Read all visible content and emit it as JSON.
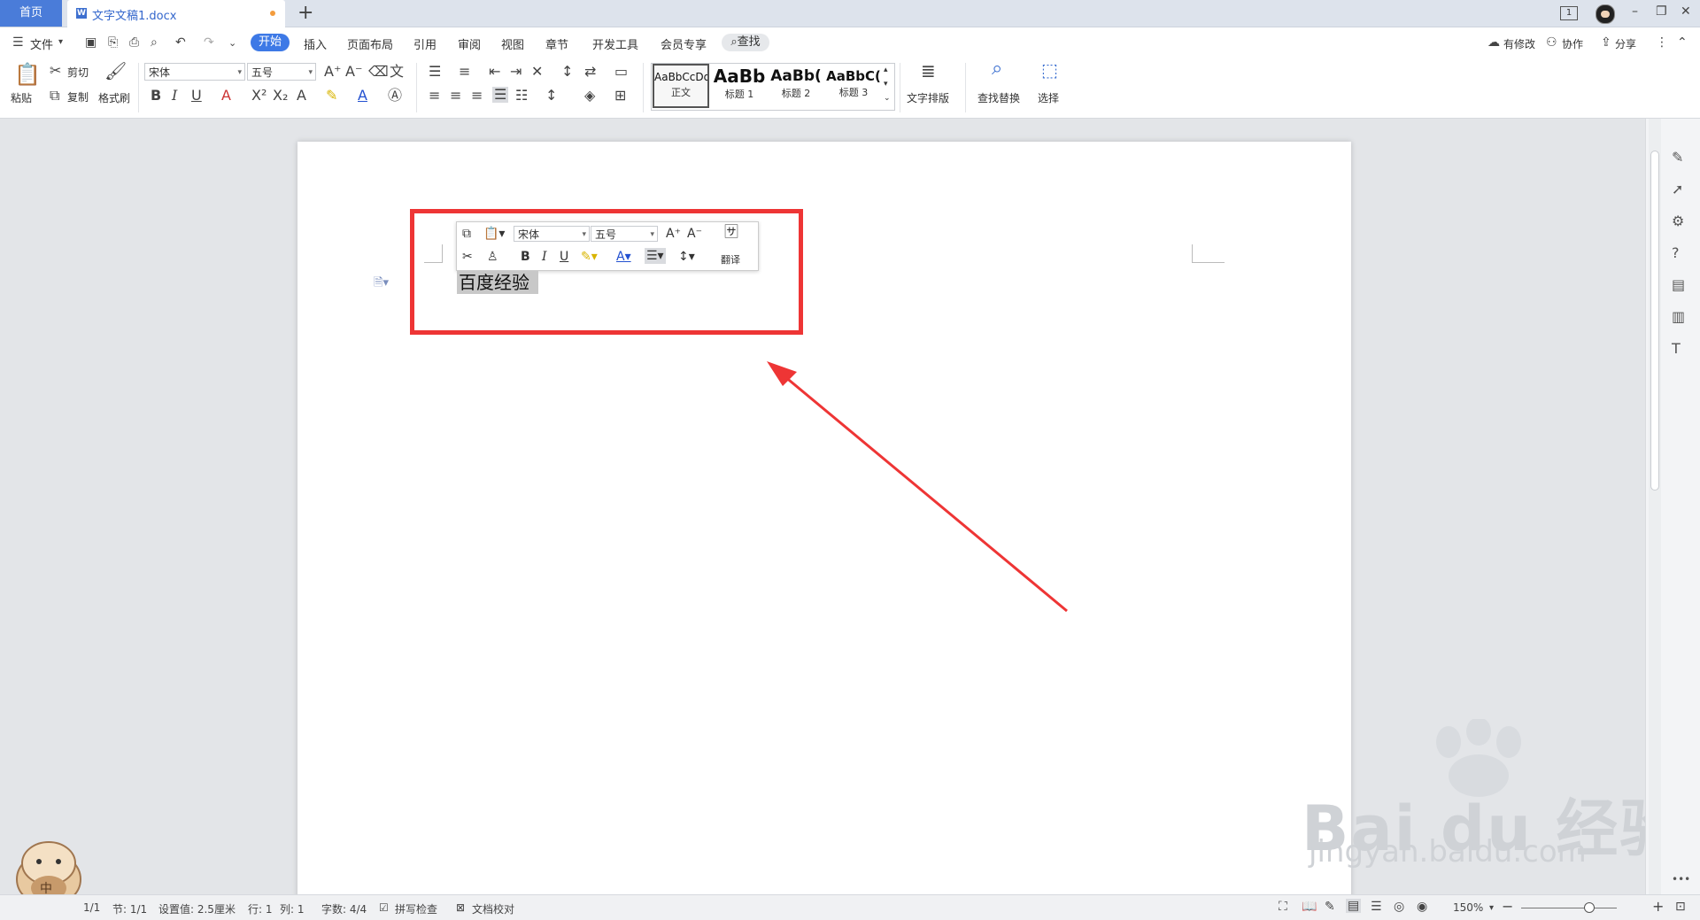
{
  "tabs": {
    "home": "首页",
    "document": "文字文稿1.docx",
    "add": "+"
  },
  "window": {
    "page_indicator": "1",
    "minimize": "–",
    "restore": "❐",
    "close": "✕"
  },
  "menu": {
    "file": "文件",
    "items": [
      "开始",
      "插入",
      "页面布局",
      "引用",
      "审阅",
      "视图",
      "章节",
      "开发工具",
      "会员专享"
    ],
    "search": "查找",
    "right": {
      "modified": "有修改",
      "collaborate": "协作",
      "share": "分享"
    }
  },
  "ribbon": {
    "paste": "粘贴",
    "cut": "剪切",
    "copy": "复制",
    "format_painter": "格式刷",
    "font_name": "宋体",
    "font_size": "五号",
    "styles": [
      {
        "sample": "AaBbCcDd",
        "name": "正文"
      },
      {
        "sample": "AaBb",
        "name": "标题 1"
      },
      {
        "sample": "AaBb(",
        "name": "标题 2"
      },
      {
        "sample": "AaBbC(",
        "name": "标题 3"
      }
    ],
    "text_layout": "文字排版",
    "find_replace": "查找替换",
    "select": "选择"
  },
  "document": {
    "body_text": "百度经验"
  },
  "mini_toolbar": {
    "font_name": "宋体",
    "font_size": "五号",
    "translate": "翻译"
  },
  "statusbar": {
    "page": "1/1",
    "section": "节: 1/1",
    "setting": "设置值: 2.5厘米",
    "row": "行: 1",
    "col": "列: 1",
    "word_count": "字数: 4/4",
    "spell_check": "拼写检查",
    "proofread": "文档校对",
    "zoom": "150%"
  },
  "watermark": {
    "main": "Bai du 经验",
    "sub": "jingyan.baidu.com"
  },
  "colors": {
    "accent": "#3d79e6",
    "highlight_box": "#ee3535",
    "tab_home": "#4a7cd9"
  }
}
